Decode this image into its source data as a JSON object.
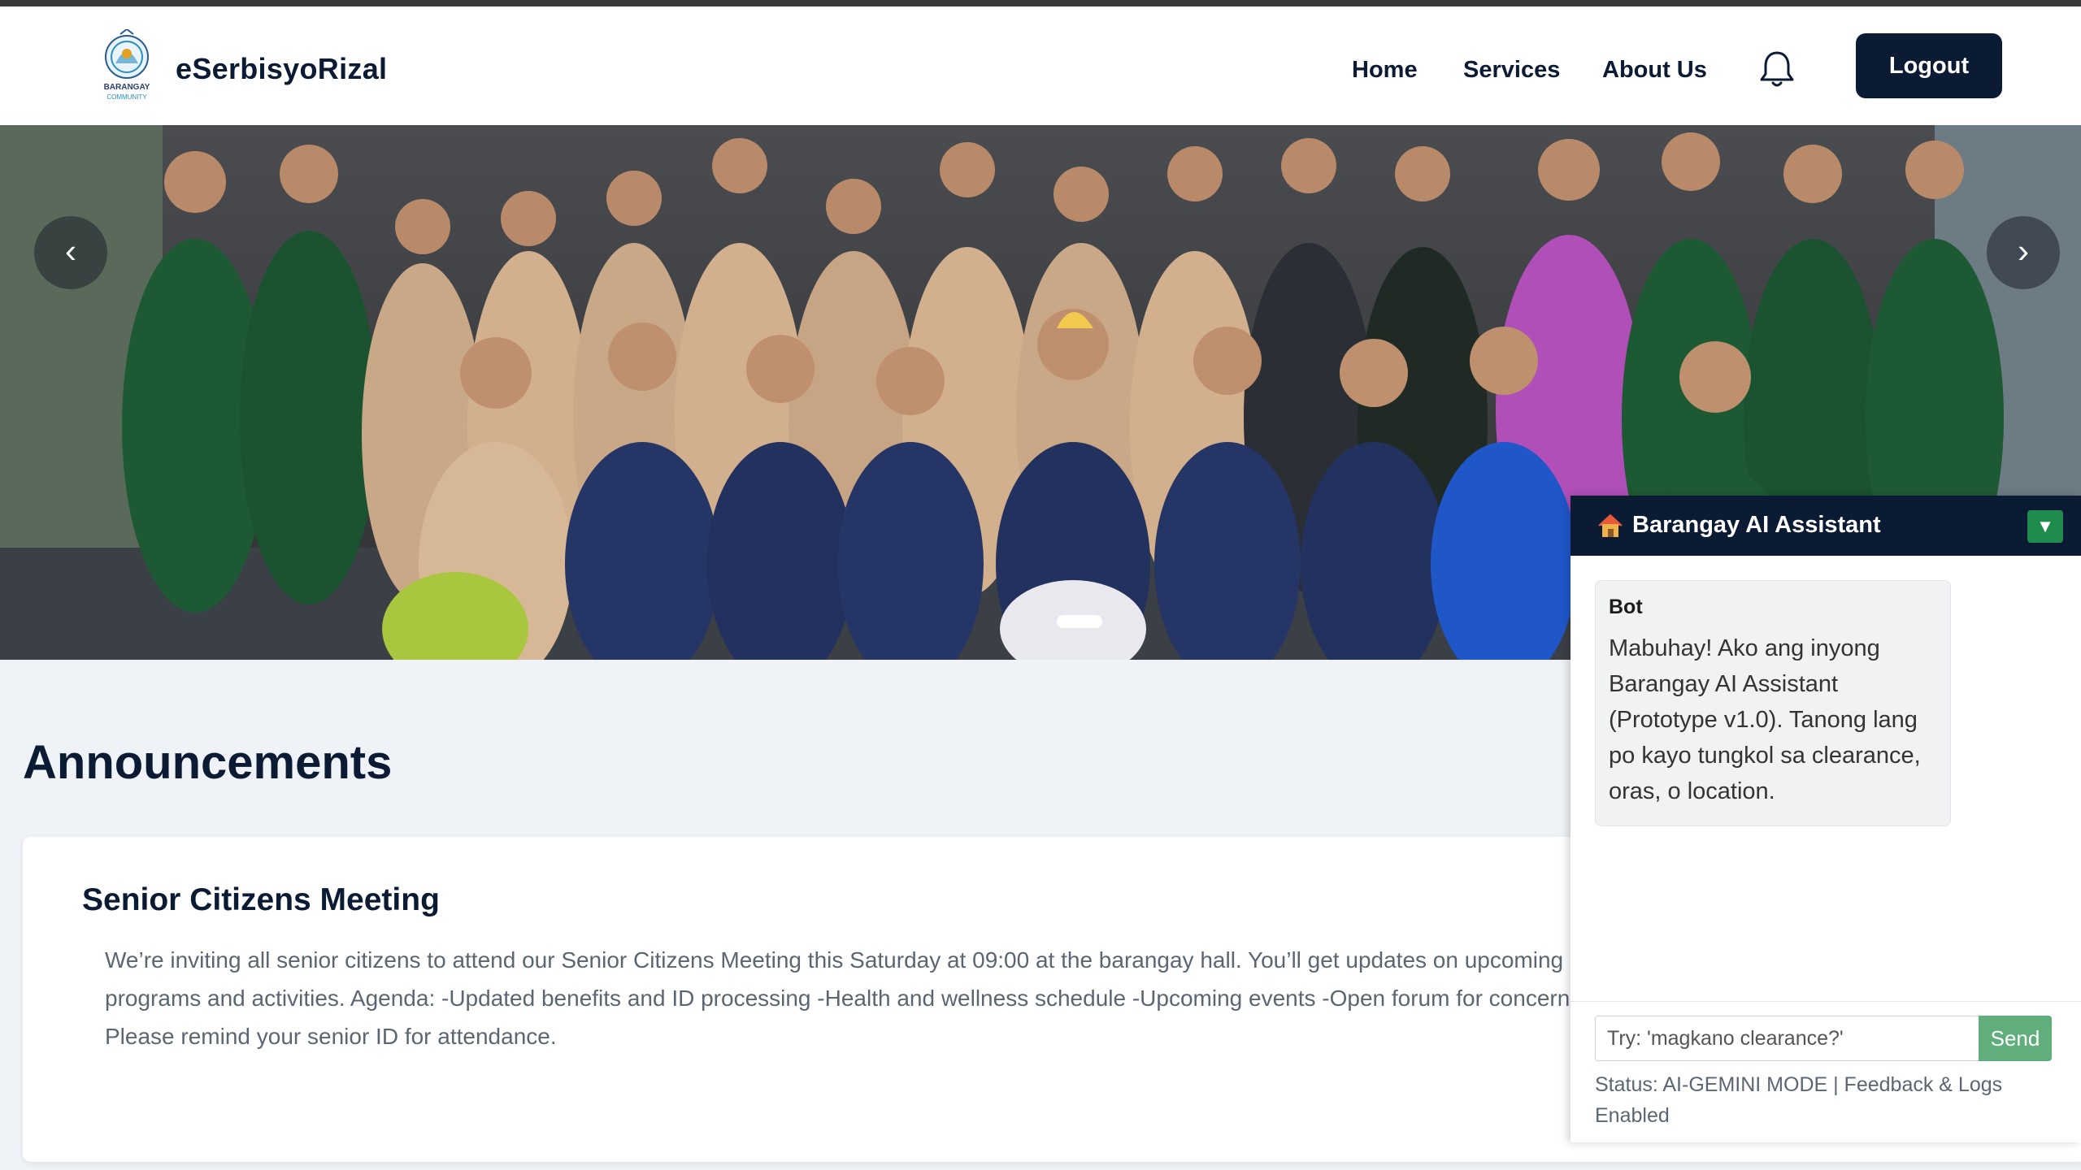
{
  "header": {
    "brand": "eSerbisyoRizal",
    "logo_text_1": "BARANGAY",
    "logo_text_2": "COMMUNITY",
    "nav": [
      {
        "label": "Home"
      },
      {
        "label": "Services"
      },
      {
        "label": "About Us"
      }
    ],
    "bell_icon": "bell-icon",
    "logout_label": "Logout"
  },
  "hero": {
    "prev_label": "‹",
    "next_label": "›",
    "active_slide": 1
  },
  "announcements": {
    "title": "Announcements",
    "items": [
      {
        "heading": "Senior Citizens Meeting",
        "body": "We’re inviting all senior citizens to attend our Senior Citizens Meeting this Saturday at 09:00 at the barangay hall. You’ll get updates on upcoming programs and activities. Agenda: -Updated benefits and ID processing -Health and wellness schedule -Upcoming events -Open forum for concerns Please remind your senior ID for attendance."
      }
    ]
  },
  "chat": {
    "title": "Barangay AI Assistant",
    "toggle": "▼",
    "messages": [
      {
        "sender": "Bot",
        "text": "Mabuhay! Ako ang inyong Barangay AI Assistant (Prototype v1.0). Tanong lang po kayo tungkol sa clearance, oras, o location."
      }
    ],
    "input_placeholder": "Try: 'magkano clearance?'",
    "send_label": "Send",
    "status": "Status: AI-GEMINI MODE | Feedback & Logs Enabled"
  },
  "colors": {
    "navy": "#0b1b33",
    "green": "#1f8b4c",
    "send_green": "#5fae7b",
    "page_bg": "#eff2f6"
  }
}
